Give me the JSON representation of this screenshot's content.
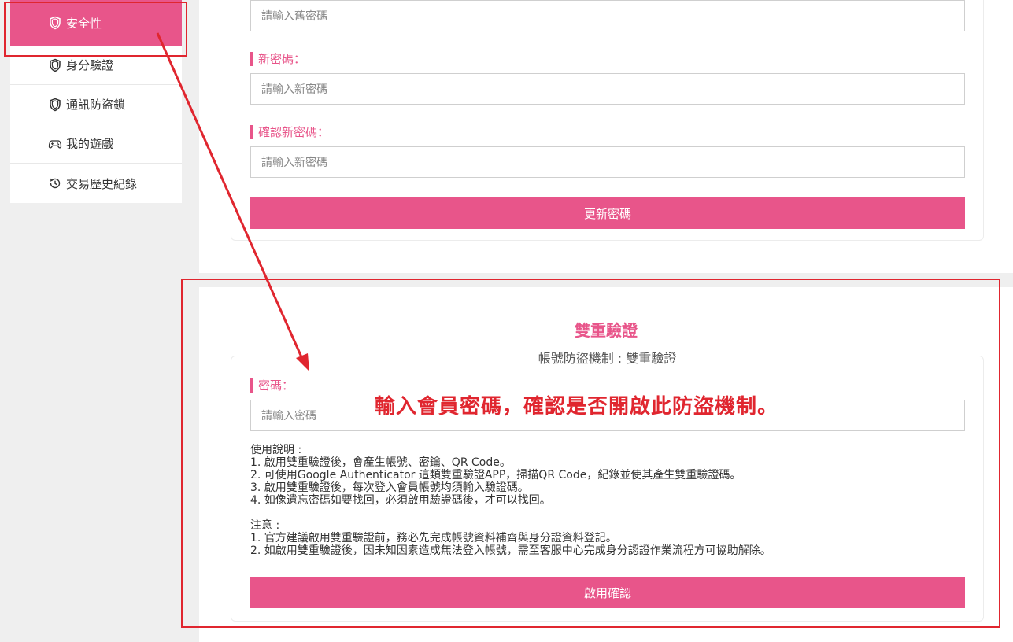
{
  "sidebar": {
    "items": [
      {
        "label": "安全性",
        "icon": "shield-icon",
        "active": true
      },
      {
        "label": "身分驗證",
        "icon": "shield-icon"
      },
      {
        "label": "通訊防盜鎖",
        "icon": "shield-icon"
      },
      {
        "label": "我的遊戲",
        "icon": "gamepad-icon"
      },
      {
        "label": "交易歷史紀錄",
        "icon": "history-icon"
      }
    ]
  },
  "password_form": {
    "old_password_placeholder": "請輸入舊密碼",
    "new_password_label": "新密碼：",
    "new_password_placeholder": "請輸入新密碼",
    "confirm_password_label": "確認新密碼：",
    "confirm_password_placeholder": "請輸入新密碼",
    "update_button": "更新密碼"
  },
  "two_factor": {
    "title": "雙重驗證",
    "legend": "帳號防盜機制 : 雙重驗證",
    "password_label": "密碼：",
    "password_placeholder": "請輸入密碼",
    "usage_title": "使用說明 :",
    "usage": [
      "1. 啟用雙重驗證後，會產生帳號、密鑰、QR Code。",
      "2. 可使用Google Authenticator 這類雙重驗證APP，掃描QR Code，紀錄並使其產生雙重驗證碼。",
      "3. 啟用雙重驗證後，每次登入會員帳號均須輸入驗證碼。",
      "4. 如像遺忘密碼如要找回，必須啟用驗證碼後，才可以找回。"
    ],
    "note_title": "注意 :",
    "notes": [
      "1. 官方建議啟用雙重驗證前，務必先完成帳號資料補齊與身分證資料登記。",
      "2. 如啟用雙重驗證後，因未知因素造成無法登入帳號，需至客服中心完成身分認證作業流程方可協助解除。"
    ],
    "enable_button": "啟用確認"
  },
  "annotation": {
    "text": "輸入會員密碼，確認是否開啟此防盜機制。",
    "color": "#e0262f"
  },
  "colors": {
    "accent": "#e8558a",
    "annotation": "#e0262f"
  }
}
